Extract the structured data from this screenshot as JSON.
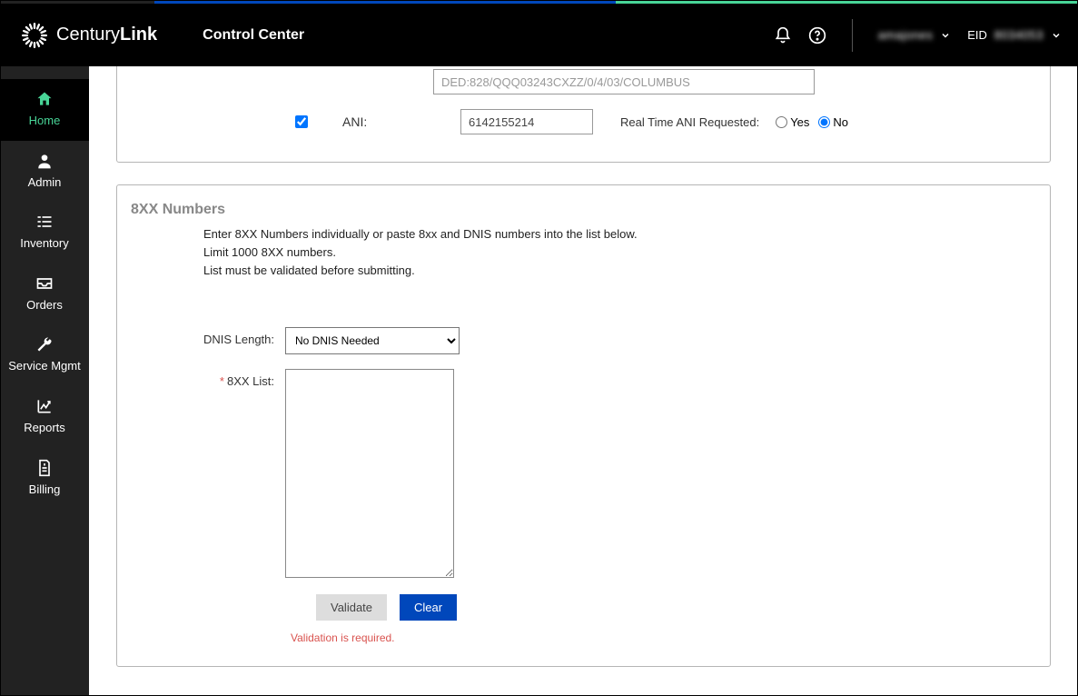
{
  "header": {
    "brand_prefix": "Century",
    "brand_suffix": "Link",
    "app_title": "Control Center",
    "user_name": "amajones",
    "eid_label": "EID",
    "eid_value": "8034053"
  },
  "sidebar": {
    "items": [
      {
        "label": "Home",
        "icon": "home"
      },
      {
        "label": "Admin",
        "icon": "user"
      },
      {
        "label": "Inventory",
        "icon": "list"
      },
      {
        "label": "Orders",
        "icon": "inbox"
      },
      {
        "label": "Service Mgmt",
        "icon": "wrench"
      },
      {
        "label": "Reports",
        "icon": "chart"
      },
      {
        "label": "Billing",
        "icon": "file"
      }
    ]
  },
  "top_panel": {
    "readonly_value": "DED:828/QQQ03243CXZZ/0/4/03/COLUMBUS",
    "ani_label": "ANI:",
    "ani_checked": true,
    "ani_value": "6142155214",
    "realtime_label": "Real Time ANI Requested:",
    "option_yes": "Yes",
    "option_no": "No",
    "realtime_selected": "No"
  },
  "xxx_section": {
    "title": "8XX Numbers",
    "instr_line1": "Enter 8XX Numbers individually or paste 8xx and DNIS numbers into the list below.",
    "instr_line2": "Limit 1000 8XX numbers.",
    "instr_line3": "List must be validated before submitting.",
    "dnis_label": "DNIS Length:",
    "dnis_value": "No DNIS Needed",
    "list_label": "8XX List:",
    "validate_label": "Validate",
    "clear_label": "Clear",
    "error_msg": "Validation is required."
  }
}
